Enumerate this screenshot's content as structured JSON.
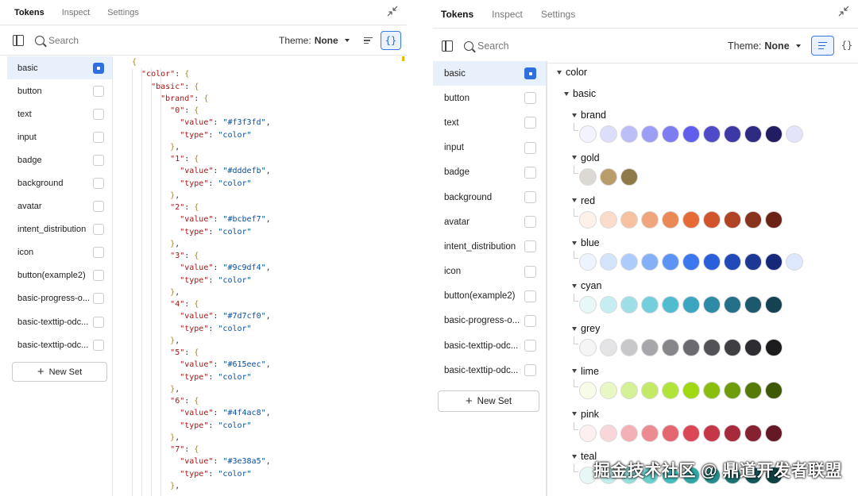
{
  "tabs": [
    "Tokens",
    "Inspect",
    "Settings"
  ],
  "toolbar": {
    "search_placeholder": "Search",
    "theme_label": "Theme:",
    "theme_value": "None",
    "list_view": "list",
    "json_view": "{}"
  },
  "sets": [
    "basic",
    "button",
    "text",
    "input",
    "badge",
    "background",
    "avatar",
    "intent_distribution",
    "icon",
    "button(example2)",
    "basic-progress-o...",
    "basic-texttip-odc...",
    "basic-texttip-odc..."
  ],
  "new_set_label": "New Set",
  "code": {
    "lines": [
      "{",
      "  \"color\": {",
      "    \"basic\": {",
      "      \"brand\": {",
      "        \"0\": {",
      "          \"value\": \"#f3f3fd\",",
      "          \"type\": \"color\"",
      "        },",
      "        \"1\": {",
      "          \"value\": \"#dddefb\",",
      "          \"type\": \"color\"",
      "        },",
      "        \"2\": {",
      "          \"value\": \"#bcbef7\",",
      "          \"type\": \"color\"",
      "        },",
      "        \"3\": {",
      "          \"value\": \"#9c9df4\",",
      "          \"type\": \"color\"",
      "        },",
      "        \"4\": {",
      "          \"value\": \"#7d7cf0\",",
      "          \"type\": \"color\"",
      "        },",
      "        \"5\": {",
      "          \"value\": \"#615eec\",",
      "          \"type\": \"color\"",
      "        },",
      "        \"6\": {",
      "          \"value\": \"#4f4ac8\",",
      "          \"type\": \"color\"",
      "        },",
      "        \"7\": {",
      "          \"value\": \"#3e38a5\",",
      "          \"type\": \"color\"",
      "        },"
    ]
  },
  "tree": {
    "root": "color",
    "group": "basic",
    "palettes": [
      {
        "name": "brand",
        "colors": [
          "#f3f3fd",
          "#dddefb",
          "#bcbef7",
          "#9c9df4",
          "#7d7cf0",
          "#615eec",
          "#4f4ac8",
          "#3e38a5",
          "#2f2b82",
          "#211d60",
          "#e3e3fa"
        ]
      },
      {
        "name": "gold",
        "colors": [
          "#dcd9d4",
          "#b99c69",
          "#8e7a48"
        ]
      },
      {
        "name": "red",
        "colors": [
          "#fdf1ea",
          "#fbdcca",
          "#f6c2a2",
          "#f0a57c",
          "#ea8856",
          "#e66a36",
          "#d0542c",
          "#b04324",
          "#8a331c",
          "#6a2314"
        ]
      },
      {
        "name": "blue",
        "colors": [
          "#eef4fe",
          "#d5e4fd",
          "#adcbfb",
          "#84b0f8",
          "#5c93f4",
          "#3b77ee",
          "#2a5fdc",
          "#2249b8",
          "#1b3894",
          "#16287a",
          "#dde8fc"
        ]
      },
      {
        "name": "cyan",
        "colors": [
          "#e8f8f9",
          "#c6eef2",
          "#9ee0e8",
          "#73cfdc",
          "#51bcd0",
          "#3aa6c0",
          "#2e8aa6",
          "#256f89",
          "#1d586d",
          "#144253"
        ]
      },
      {
        "name": "grey",
        "colors": [
          "#f5f5f6",
          "#e4e4e6",
          "#c8c8cb",
          "#a7a7ab",
          "#86868b",
          "#6a6a70",
          "#525257",
          "#3e3e43",
          "#2d2d31",
          "#1c1c1f"
        ]
      },
      {
        "name": "lime",
        "colors": [
          "#f7fce8",
          "#e8f7c4",
          "#d5f195",
          "#c4ea65",
          "#b2e33b",
          "#a0d912",
          "#89bf0c",
          "#6f9c09",
          "#567a07",
          "#3f5806"
        ]
      },
      {
        "name": "pink",
        "colors": [
          "#fdf0f1",
          "#f9d6d9",
          "#f3b0b6",
          "#ec8b92",
          "#e46671",
          "#dc4757",
          "#c63649",
          "#a62a3c",
          "#852131",
          "#651826"
        ]
      },
      {
        "name": "teal",
        "colors": [
          "#e6f7f6",
          "#c2eeec",
          "#97e0dd",
          "#6bd0cc",
          "#45bebb",
          "#2ea8a6",
          "#248c8c",
          "#1c7173",
          "#15585b",
          "#0f4244"
        ]
      }
    ]
  },
  "watermark": "掘金技术社区 @ 鼎道开发者联盟"
}
